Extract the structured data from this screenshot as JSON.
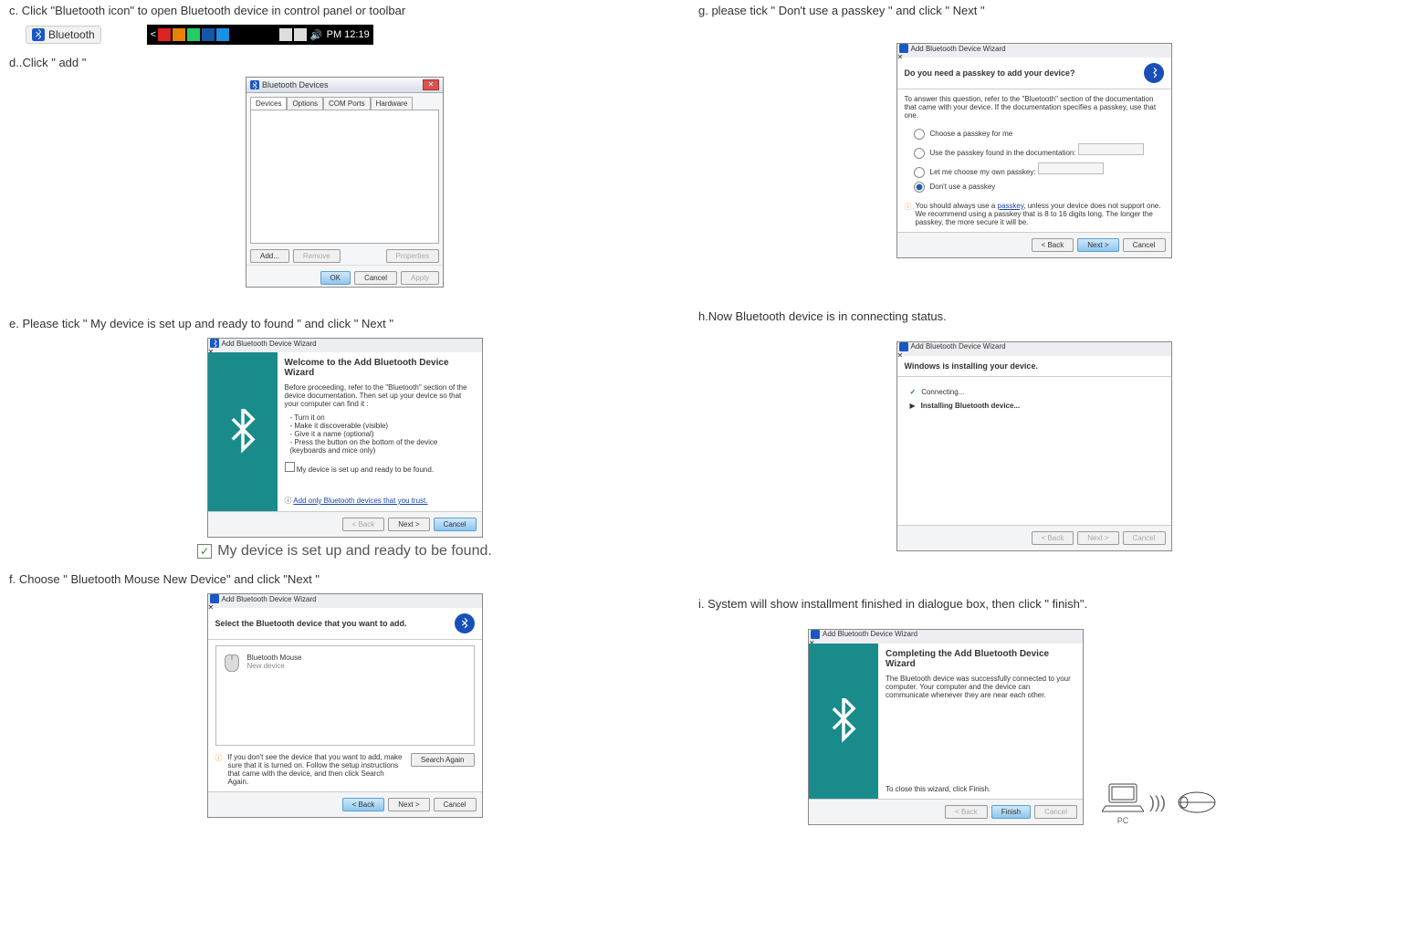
{
  "left": {
    "step_c": "c. Click \"Bluetooth icon\" to open Bluetooth device in control panel or toolbar",
    "bt_label": "Bluetooth",
    "tray_time": "PM 12:19",
    "step_d": "d..Click \" add \"",
    "bt_devices": {
      "title": "Bluetooth Devices",
      "tabs": [
        "Devices",
        "Options",
        "COM Ports",
        "Hardware"
      ],
      "add": "Add...",
      "remove": "Remove",
      "properties": "Properties",
      "ok": "OK",
      "cancel": "Cancel",
      "apply": "Apply"
    },
    "step_e": "e. Please tick \" My device is set up and ready to found \" and click  \" Next \"",
    "wiz_e": {
      "title": "Add Bluetooth Device Wizard",
      "heading": "Welcome to the Add Bluetooth Device Wizard",
      "p1": "Before proceeding, refer to the \"Bluetooth\" section of the device documentation. Then set up your device so that your computer can find it :",
      "b1": "- Turn it on",
      "b2": "- Make it discoverable (visible)",
      "b3": "- Give it a name (optional)",
      "b4": "- Press the button on the bottom of the device (keyboards and mice only)",
      "check": "My device is set up and ready to be found.",
      "tip": "Add only Bluetooth devices that you trust.",
      "back": "< Back",
      "next": "Next >",
      "cancel": "Cancel"
    },
    "check_enlarged": "My device is set up and ready to be found.",
    "step_f": "f. Choose \" Bluetooth Mouse New Device\" and click \"Next \"",
    "wiz_f": {
      "title": "Add Bluetooth Device Wizard",
      "heading": "Select the Bluetooth device that you want to add.",
      "item_title": "Bluetooth Mouse",
      "item_sub": "New device",
      "tip": "If you don't see the device that you want to add, make sure that it is turned on. Follow the setup instructions that came with the device, and then click Search Again.",
      "search_again": "Search Again",
      "back": "< Back",
      "next": "Next >",
      "cancel": "Cancel"
    }
  },
  "right": {
    "step_g": "g. please tick \" Don't use a passkey \" and click \" Next \"",
    "wiz_g": {
      "title": "Add Bluetooth Device Wizard",
      "heading": "Do you need a passkey to add your device?",
      "lead": "To answer this question, refer to the \"Bluetooth\" section of the documentation that came with your device. If the documentation specifies a passkey, use that one.",
      "opt1": "Choose a passkey for me",
      "opt2": "Use the passkey found in the documentation:",
      "opt3": "Let me choose my own passkey:",
      "opt4": "Don't use a passkey",
      "tip_pre": "You should always use a ",
      "tip_link": "passkey",
      "tip_post": ", unless your device does not support one. We recommend using a passkey that is 8 to 16 digits long. The longer the passkey, the more secure it will be.",
      "back": "< Back",
      "next": "Next >",
      "cancel": "Cancel"
    },
    "step_h": "h.Now Bluetooth device is in connecting status.",
    "wiz_h": {
      "title": "Add Bluetooth Device Wizard",
      "heading": "Windows is installing your device.",
      "l1": "Connecting...",
      "l2": "Installing Bluetooth device...",
      "back": "< Back",
      "next": "Next >",
      "cancel": "Cancel"
    },
    "step_i": "i. System will show installment finished in dialogue box, then click \" finish\".",
    "wiz_i": {
      "title": "Add Bluetooth Device Wizard",
      "heading": "Completing the Add Bluetooth Device Wizard",
      "p1": "The Bluetooth device was successfully connected to your computer. Your computer and the device can communicate whenever they are near each other.",
      "p2": "To close this wizard, click Finish.",
      "back": "< Back",
      "finish": "Finish",
      "cancel": "Cancel"
    },
    "pc_label": "PC"
  }
}
